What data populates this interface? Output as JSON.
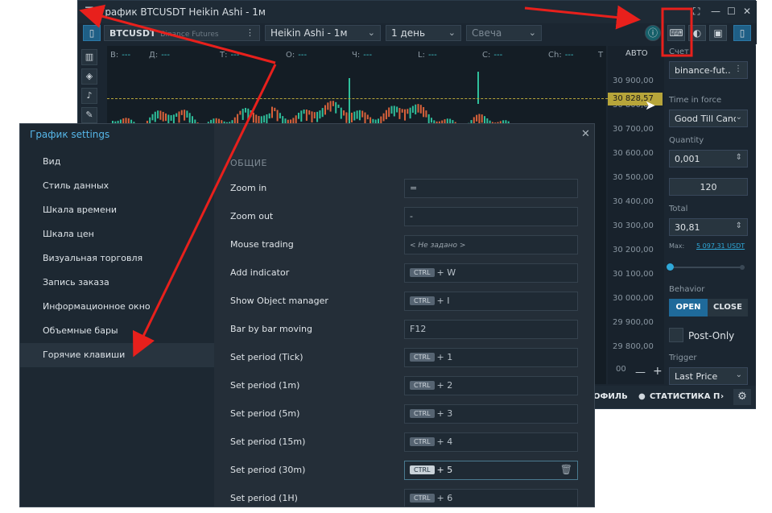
{
  "window": {
    "title": "График BTCUSDT Heikin Ashi - 1м",
    "menu_icon": "hamburger-icon",
    "controls": [
      "⛶",
      "—",
      "☐",
      "✕"
    ]
  },
  "toolbar": {
    "symbol": "BTCUSDT",
    "exchange": "Binance Futures",
    "chart_type": "Heikin Ashi - 1м",
    "period": "1 день",
    "style": "Свеча"
  },
  "ohlc": {
    "labels": [
      "В:",
      "Д:",
      "Т:",
      "О:",
      "Ч:",
      "L:",
      "С:",
      "Ch:",
      "Т"
    ],
    "value": "---"
  },
  "price_axis": {
    "mode": "АВТО",
    "prices": [
      "30 900,00",
      "30 800,00",
      "30 700,00",
      "30 600,00",
      "30 500,00",
      "30 400,00",
      "30 300,00",
      "30 200,00",
      "30 100,00",
      "30 000,00",
      "29 900,00",
      "29 800,00"
    ],
    "current": "30 828,57",
    "bottom_value": "00"
  },
  "right_panel": {
    "account_label": "Счет",
    "account": "binance-fut..",
    "tif_label": "Time in force",
    "tif": "Good Till Canc",
    "qty_label": "Quantity",
    "qty": "0,001",
    "amount": "120",
    "total_label": "Total",
    "total": "30,81",
    "max_label": "Max:",
    "max_value": "5 097,31 USDT",
    "behavior_label": "Behavior",
    "open": "OPEN",
    "close": "CLOSE",
    "post_only": "Post-Only",
    "trigger_label": "Trigger",
    "trigger": "Last Price"
  },
  "bottom_bar": {
    "profile": "ОФИЛЬ",
    "stats": "СТАТИСТИКА П"
  },
  "dialog": {
    "title": "График settings",
    "close": "✕",
    "section": "ОБЩИЕ",
    "nav": [
      "Вид",
      "Стиль данных",
      "Шкала времени",
      "Шкала цен",
      "Визуальная торговля",
      "Запись заказа",
      "Информационное окно",
      "Объемные бары",
      "Горячие клавиши"
    ],
    "rows": [
      {
        "label": "Zoom in",
        "ctrl": false,
        "value": "="
      },
      {
        "label": "Zoom out",
        "ctrl": false,
        "value": "-"
      },
      {
        "label": "Mouse trading",
        "ctrl": false,
        "value": "< Не задано >"
      },
      {
        "label": "Add indicator",
        "ctrl": true,
        "value": "+ W"
      },
      {
        "label": "Show Object manager",
        "ctrl": true,
        "value": "+ I"
      },
      {
        "label": "Bar by bar moving",
        "ctrl": false,
        "value": "F12"
      },
      {
        "label": "Set period (Tick)",
        "ctrl": true,
        "value": "+ 1"
      },
      {
        "label": "Set period (1m)",
        "ctrl": true,
        "value": "+ 2"
      },
      {
        "label": "Set period (5m)",
        "ctrl": true,
        "value": "+ 3"
      },
      {
        "label": "Set period (15m)",
        "ctrl": true,
        "value": "+ 4"
      },
      {
        "label": "Set period (30m)",
        "ctrl": true,
        "value": "+ 5"
      },
      {
        "label": "Set period (1H)",
        "ctrl": true,
        "value": "+ 6"
      }
    ],
    "ctrl_text": "CTRL"
  },
  "colors": {
    "accent_blue": "#56b6e8",
    "annotation_red": "#e8201c",
    "candle_green": "#2fbf9b",
    "candle_red": "#d9623b"
  }
}
